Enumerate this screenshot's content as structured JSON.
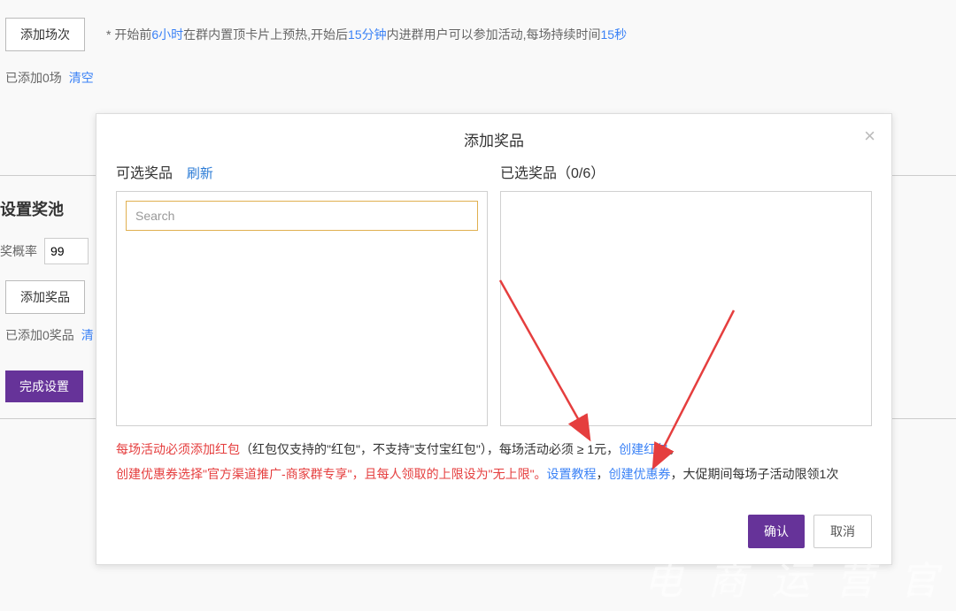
{
  "background": {
    "add_round_btn": "添加场次",
    "hint_prefix": "* 开始前",
    "hint_t1": "6小时",
    "hint_mid1": "在群内置顶卡片上预热,开始后",
    "hint_t2": "15分钟",
    "hint_mid2": "内进群用户可以参加活动,每场持续时间",
    "hint_t3": "15秒",
    "added_rounds": "已添加0场",
    "clear": "清空",
    "pool_title": "设置奖池",
    "rate_label": "奖概率",
    "rate_value": "99",
    "add_prize_btn": "添加奖品",
    "added_prizes": "已添加0奖品",
    "clear2": "清",
    "finish_btn": "完成设置"
  },
  "modal": {
    "title": "添加奖品",
    "left_title": "可选奖品",
    "refresh": "刷新",
    "search_placeholder": "Search",
    "right_title": "已选奖品（0/6）",
    "note_red_prefix_1": "每场活动必须添加红包",
    "note_black_1": "（红包仅支持的\"红包\"，不支持\"支付宝红包\"），每场活动必须 ≥ 1元，",
    "note_link_1": "创建红包",
    "note_period_1": "。",
    "note_red_prefix_2": "创建优惠券选择\"官方渠道推广-商家群专享\"，且每人领取的上限设为\"无上限\"。",
    "note_link_2a": "设置教程",
    "note_comma": "，",
    "note_link_2b": "创建优惠券",
    "note_black_2": "，大促期间每场子活动限领1次",
    "confirm": "确认",
    "cancel": "取消"
  },
  "watermark": "电 商 运 营 官"
}
